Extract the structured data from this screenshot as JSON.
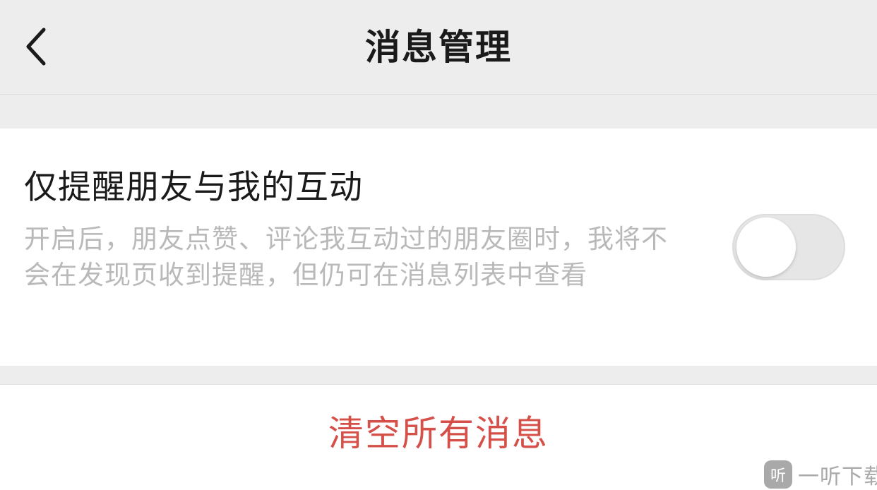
{
  "navbar": {
    "back_icon": "chevron-left-icon",
    "title": "消息管理"
  },
  "setting": {
    "title": "仅提醒朋友与我的互动",
    "description": "开启后，朋友点赞、评论我互动过的朋友圈时，我将不会在发现页收到提醒，但仍可在消息列表中查看",
    "toggle_on": false
  },
  "actions": {
    "clear_all_label": "清空所有消息",
    "clear_all_color": "#d6504a"
  },
  "watermark": {
    "logo_text": "听",
    "text": "一听下载"
  }
}
